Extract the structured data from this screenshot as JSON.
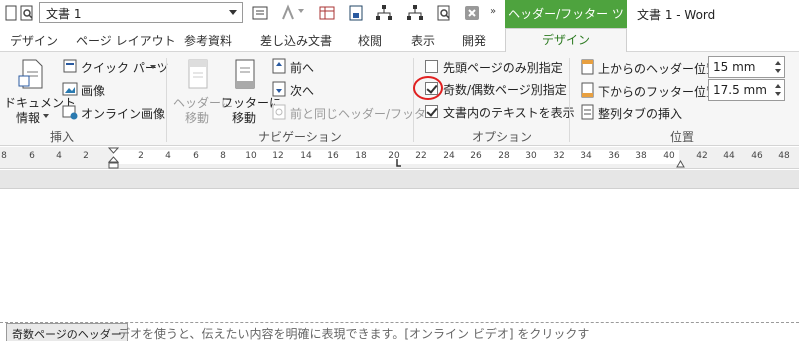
{
  "qat": {
    "document_name": "文書 1",
    "context_tab": "ヘッダー/フッター ツール",
    "window_title": "文書 1 - Word"
  },
  "tabs": [
    "デザイン",
    "ページ レイアウト",
    "参考資料",
    "差し込み文書",
    "校閲",
    "表示",
    "開発",
    "デザイン"
  ],
  "insert_group": {
    "doc_info": [
      "ドキュメント",
      "情報"
    ],
    "quick_parts": "クイック パーツ",
    "picture": "画像",
    "online_picture": "オンライン画像",
    "label": "挿入"
  },
  "nav_group": {
    "goto_header": [
      "ヘッダーに",
      "移動"
    ],
    "goto_footer": [
      "フッターに",
      "移動"
    ],
    "previous": "前へ",
    "next": "次へ",
    "link_previous": "前と同じヘッダー/フッター",
    "label": "ナビゲーション"
  },
  "options_group": {
    "first_page": "先頭ページのみ別指定",
    "odd_even": "奇数/偶数ページ別指定",
    "show_text": "文書内のテキストを表示",
    "label": "オプション"
  },
  "position_group": {
    "header_from_top": "上からのヘッダー位置:",
    "header_value": "15 mm",
    "footer_from_bottom": "下からのフッター位置:",
    "footer_value": "17.5 mm",
    "insert_tab": "整列タブの挿入",
    "label": "位置"
  },
  "ruler": {
    "ticks": [
      "8",
      "6",
      "4",
      "2",
      "2",
      "4",
      "6",
      "8",
      "10",
      "12",
      "14",
      "16",
      "18",
      "20",
      "22",
      "24",
      "26",
      "28",
      "30",
      "32",
      "34",
      "36",
      "38",
      "40",
      "42",
      "44",
      "46",
      "48"
    ]
  },
  "document": {
    "header_tag": "奇数ページのヘッダー",
    "body_text": "デオを使うと、伝えたい内容を明確に表現できます。[オンライン ビデオ] をクリックす"
  },
  "colors": {
    "accent": "#4ea33e",
    "annotation": "#e02020"
  }
}
